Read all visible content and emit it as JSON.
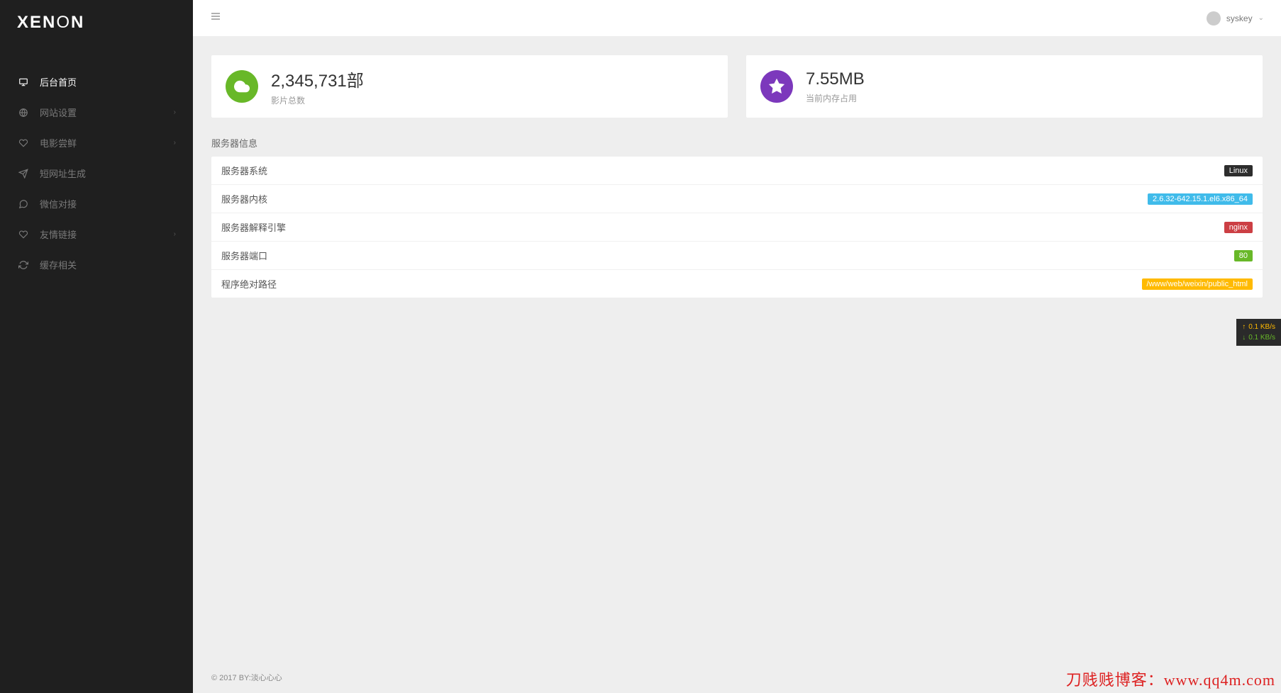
{
  "brand": "XENON",
  "sidebar": {
    "items": [
      {
        "label": "后台首页",
        "icon": "monitor",
        "active": true
      },
      {
        "label": "网站设置",
        "icon": "globe",
        "expandable": true
      },
      {
        "label": "电影尝鲜",
        "icon": "heart",
        "expandable": true
      },
      {
        "label": "短网址生成",
        "icon": "send"
      },
      {
        "label": "微信对接",
        "icon": "chat"
      },
      {
        "label": "友情链接",
        "icon": "heart",
        "expandable": true
      },
      {
        "label": "缓存相关",
        "icon": "refresh"
      }
    ]
  },
  "header": {
    "username": "syskey"
  },
  "stats": [
    {
      "value": "2,345,731部",
      "label": "影片总数",
      "icon": "cloud",
      "color": "green"
    },
    {
      "value": "7.55MB",
      "label": "当前内存占用",
      "icon": "star",
      "color": "purple"
    }
  ],
  "server_info": {
    "title": "服务器信息",
    "rows": [
      {
        "label": "服务器系统",
        "value": "Linux",
        "badge": "dark"
      },
      {
        "label": "服务器内核",
        "value": "2.6.32-642.15.1.el6.x86_64",
        "badge": "blue"
      },
      {
        "label": "服务器解释引擎",
        "value": "nginx",
        "badge": "red"
      },
      {
        "label": "服务器端口",
        "value": "80",
        "badge": "green"
      },
      {
        "label": "程序绝对路径",
        "value": "/www/web/weixin/public_html",
        "badge": "orange"
      }
    ]
  },
  "footer": "© 2017 BY:淡心心心",
  "network": {
    "up": "0.1 KB/s",
    "down": "0.1 KB/s"
  },
  "watermark": "刀贱贱博客：www.qq4m.com"
}
